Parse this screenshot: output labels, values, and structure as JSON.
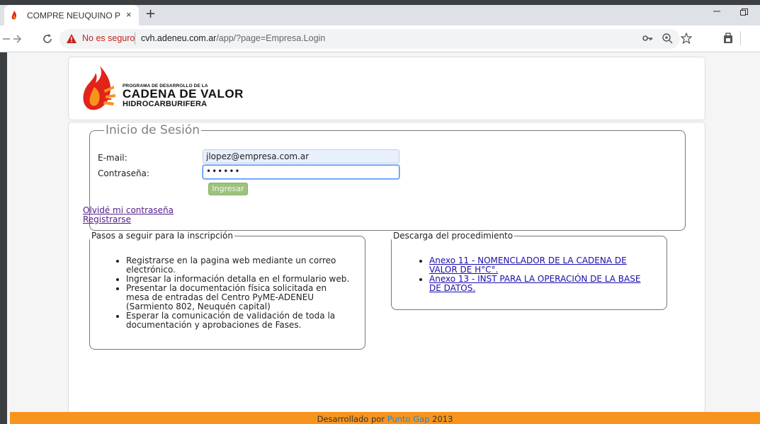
{
  "browser": {
    "tab_title": "COMPRE NEUQUINO PETROLERO",
    "tab_close": "×",
    "new_tab": "+",
    "security_label": "No es seguro",
    "url_host": "cvh.adeneu.com.ar",
    "url_path": "/app/?page=Empresa.Login",
    "icons": [
      "back-icon",
      "forward-icon",
      "reload-icon",
      "warning-icon",
      "key-icon",
      "zoom-icon",
      "star-icon",
      "extension-icon",
      "minimize-icon",
      "restore-icon"
    ]
  },
  "header": {
    "logo_line1": "PROGRAMA DE DESARROLLO DE LA",
    "logo_line2": "CADENA DE VALOR",
    "logo_line3": "HIDROCARBURIFERA"
  },
  "login": {
    "legend": "Inicio de Sesión",
    "email_label": "E-mail:",
    "email_value": "jlopez@empresa.com.ar",
    "password_label": "Contraseña:",
    "password_value": "••••••",
    "submit_label": "Ingresar",
    "forgot_link": "Olvidé mi contraseña",
    "register_link": "Registrarse"
  },
  "steps": {
    "legend": "Pasos a seguir para la inscripción",
    "items": [
      "Registrarse en la pagina web mediante un correo electrónico.",
      "Ingresar la información detalla en el formulario web.",
      "Presentar la documentación física solicitada en mesa de entradas del Centro PyME-ADENEU (Sarmiento 802, Neuquén capital)",
      "Esperar la comunicación de validación de toda la documentación y aprobaciones de Fases."
    ]
  },
  "downloads": {
    "legend": "Descarga del procedimiento",
    "items": [
      "Anexo 11 - NOMENCLADOR DE LA CADENA DE VALOR DE H°C°.",
      "Anexo 13 - INST PARA LA OPERACIÓN DE LA BASE DE DATOS."
    ]
  },
  "footer": {
    "prefix": "Desarrollado por",
    "brand": "Punto Gap",
    "year": "2013"
  },
  "colors": {
    "footer_bg": "#f7941d",
    "button_bg": "#9dc27e",
    "link": "#1a0dab",
    "visited_link": "#551a8b",
    "logo_red": "#e2231a",
    "logo_orange": "#f7941d"
  }
}
